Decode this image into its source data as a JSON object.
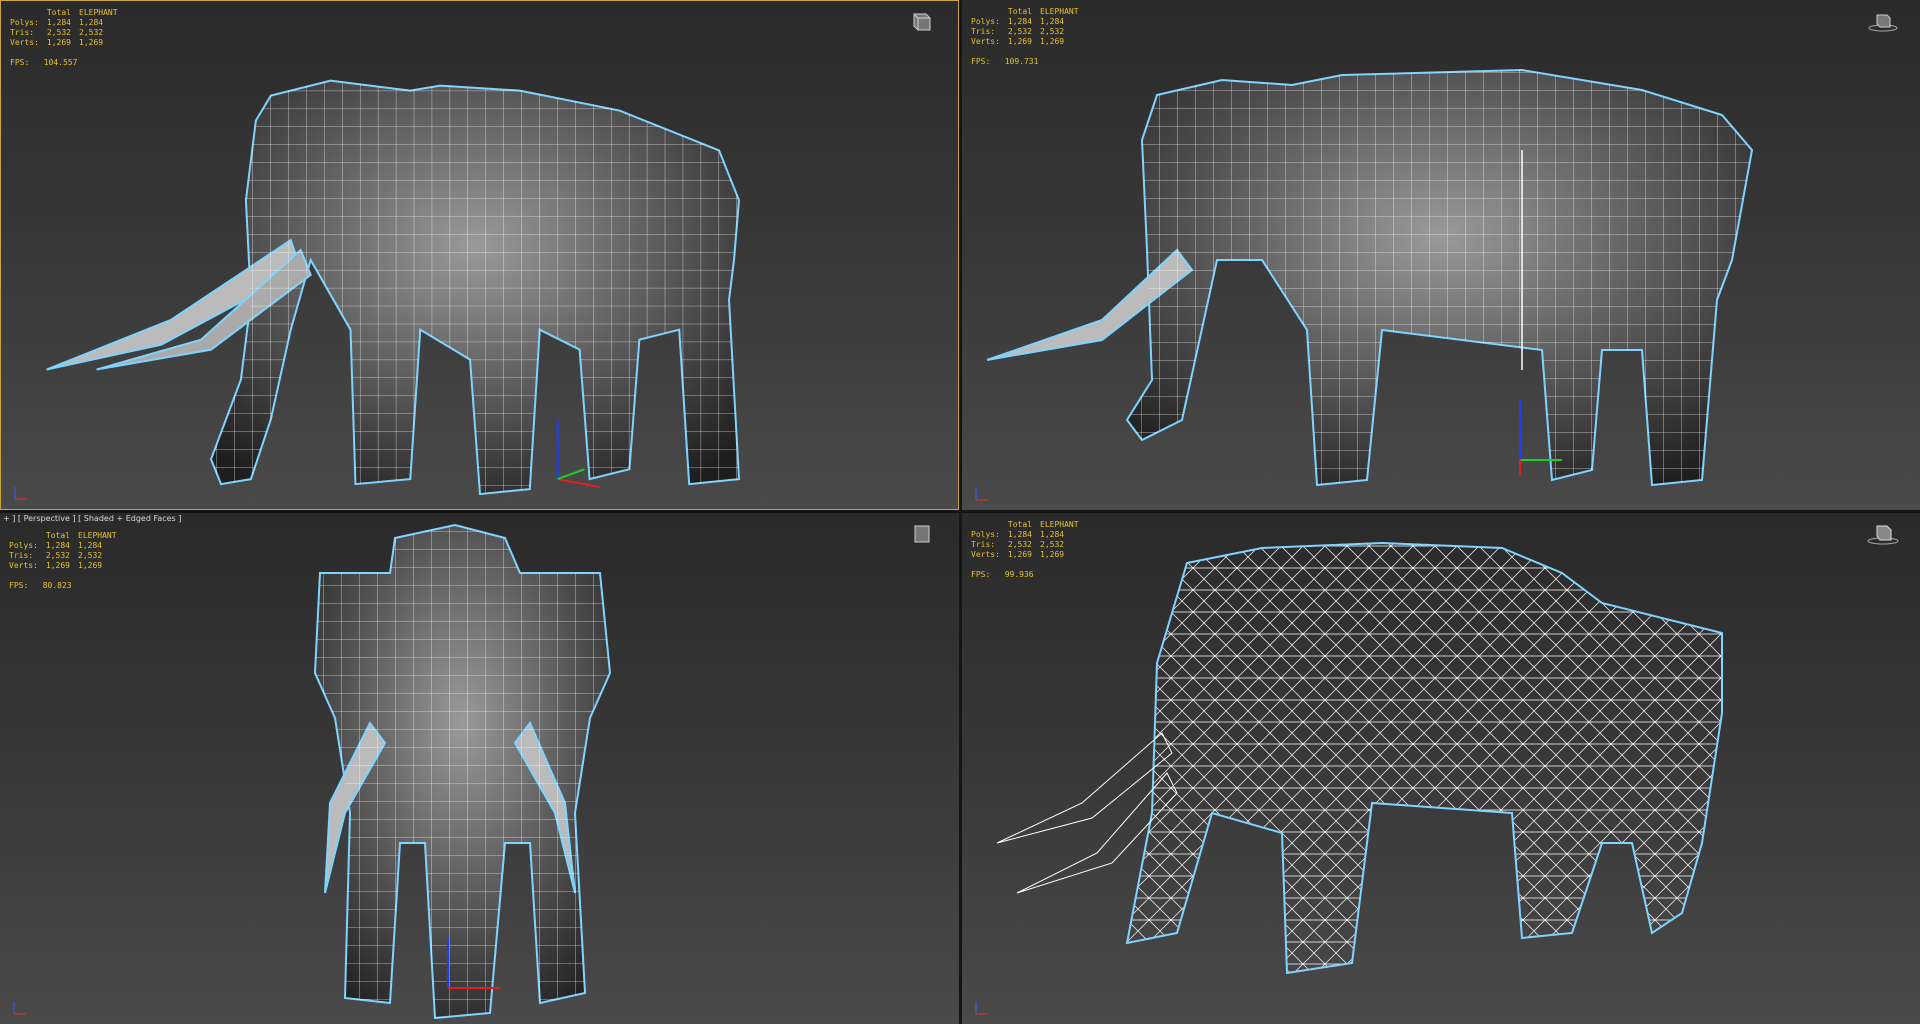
{
  "viewports": {
    "tl": {
      "col_total": "Total",
      "col_object": "ELEPHANT",
      "rows": [
        {
          "label": "Polys:",
          "total": "1,284",
          "object": "1,284"
        },
        {
          "label": "Tris:",
          "total": "2,532",
          "object": "2,532"
        },
        {
          "label": "Verts:",
          "total": "1,269",
          "object": "1,269"
        }
      ],
      "fps_label": "FPS:",
      "fps": "104.557"
    },
    "tr": {
      "col_total": "Total",
      "col_object": "ELEPHANT",
      "rows": [
        {
          "label": "Polys:",
          "total": "1,284",
          "object": "1,284"
        },
        {
          "label": "Tris:",
          "total": "2,532",
          "object": "2,532"
        },
        {
          "label": "Verts:",
          "total": "1,269",
          "object": "1,269"
        }
      ],
      "fps_label": "FPS:",
      "fps": "109.731"
    },
    "bl": {
      "label": "+ ] [ Perspective ] [ Shaded + Edged Faces ]",
      "col_total": "Total",
      "col_object": "ELEPHANT",
      "rows": [
        {
          "label": "Polys:",
          "total": "1,284",
          "object": "1,284"
        },
        {
          "label": "Tris:",
          "total": "2,532",
          "object": "2,532"
        },
        {
          "label": "Verts:",
          "total": "1,269",
          "object": "1,269"
        }
      ],
      "fps_label": "FPS:",
      "fps": "80.823"
    },
    "br": {
      "col_total": "Total",
      "col_object": "ELEPHANT",
      "rows": [
        {
          "label": "Polys:",
          "total": "1,284",
          "object": "1,284"
        },
        {
          "label": "Tris:",
          "total": "2,532",
          "object": "2,532"
        },
        {
          "label": "Verts:",
          "total": "1,269",
          "object": "1,269"
        }
      ],
      "fps_label": "FPS:",
      "fps": "99.936"
    }
  },
  "icons": {
    "viewcube": "viewcube-icon",
    "axis": "axis-tripod-icon",
    "model": "elephant-mesh-icon"
  },
  "colors": {
    "stats_text": "#e6c12f",
    "active_border": "#c9a43a",
    "wire": "#ffffff",
    "selection_outline": "#7fd4ff"
  }
}
